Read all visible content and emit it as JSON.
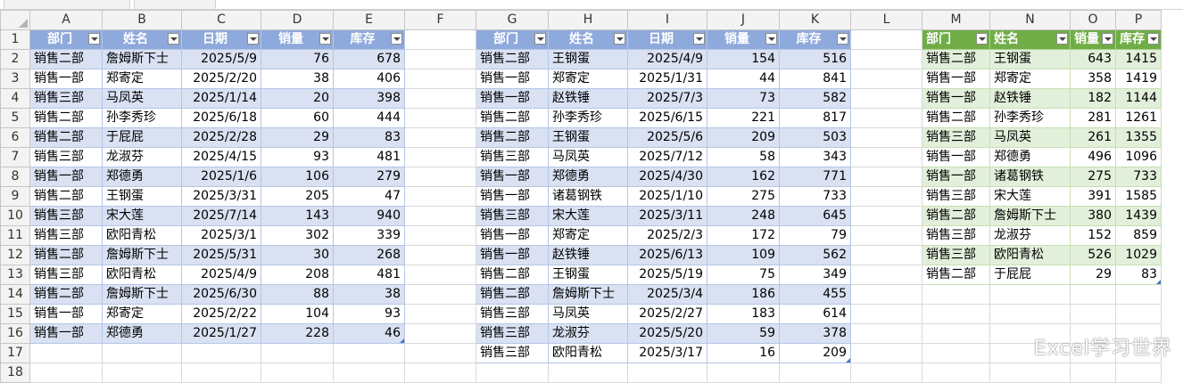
{
  "columns": [
    "A",
    "B",
    "C",
    "D",
    "E",
    "F",
    "G",
    "H",
    "I",
    "J",
    "K",
    "L",
    "M",
    "N",
    "O",
    "P"
  ],
  "row_numbers": [
    "1",
    "2",
    "3",
    "4",
    "5",
    "6",
    "7",
    "8",
    "9",
    "10",
    "11",
    "12",
    "13",
    "14",
    "15",
    "16",
    "17",
    "18"
  ],
  "table1": {
    "headers": [
      "部门",
      "姓名",
      "日期",
      "销量",
      "库存"
    ],
    "rows": [
      [
        "销售二部",
        "詹姆斯下士",
        "2025/5/9",
        "76",
        "678"
      ],
      [
        "销售一部",
        "郑寄定",
        "2025/2/20",
        "38",
        "406"
      ],
      [
        "销售三部",
        "马凤英",
        "2025/1/14",
        "20",
        "398"
      ],
      [
        "销售二部",
        "孙李秀珍",
        "2025/6/18",
        "60",
        "444"
      ],
      [
        "销售二部",
        "于屁屁",
        "2025/2/28",
        "29",
        "83"
      ],
      [
        "销售三部",
        "龙淑芬",
        "2025/4/15",
        "93",
        "481"
      ],
      [
        "销售一部",
        "郑德勇",
        "2025/1/6",
        "106",
        "279"
      ],
      [
        "销售二部",
        "王钢蛋",
        "2025/3/31",
        "205",
        "47"
      ],
      [
        "销售三部",
        "宋大莲",
        "2025/7/14",
        "143",
        "940"
      ],
      [
        "销售三部",
        "欧阳青松",
        "2025/3/1",
        "302",
        "339"
      ],
      [
        "销售二部",
        "詹姆斯下士",
        "2025/5/31",
        "30",
        "268"
      ],
      [
        "销售三部",
        "欧阳青松",
        "2025/4/9",
        "208",
        "481"
      ],
      [
        "销售二部",
        "詹姆斯下士",
        "2025/6/30",
        "88",
        "38"
      ],
      [
        "销售一部",
        "郑寄定",
        "2025/2/22",
        "104",
        "93"
      ],
      [
        "销售一部",
        "郑德勇",
        "2025/1/27",
        "228",
        "46"
      ]
    ]
  },
  "table2": {
    "headers": [
      "部门",
      "姓名",
      "日期",
      "销量",
      "库存"
    ],
    "rows": [
      [
        "销售二部",
        "王钢蛋",
        "2025/4/9",
        "154",
        "516"
      ],
      [
        "销售一部",
        "郑寄定",
        "2025/1/31",
        "44",
        "841"
      ],
      [
        "销售一部",
        "赵铁锤",
        "2025/7/3",
        "73",
        "582"
      ],
      [
        "销售二部",
        "孙李秀珍",
        "2025/6/15",
        "221",
        "817"
      ],
      [
        "销售二部",
        "王钢蛋",
        "2025/5/6",
        "209",
        "503"
      ],
      [
        "销售三部",
        "马凤英",
        "2025/7/12",
        "58",
        "343"
      ],
      [
        "销售一部",
        "郑德勇",
        "2025/4/30",
        "162",
        "771"
      ],
      [
        "销售一部",
        "诸葛钢铁",
        "2025/1/10",
        "275",
        "733"
      ],
      [
        "销售三部",
        "宋大莲",
        "2025/3/11",
        "248",
        "645"
      ],
      [
        "销售一部",
        "郑寄定",
        "2025/2/3",
        "172",
        "79"
      ],
      [
        "销售一部",
        "赵铁锤",
        "2025/6/13",
        "109",
        "562"
      ],
      [
        "销售二部",
        "王钢蛋",
        "2025/5/19",
        "75",
        "349"
      ],
      [
        "销售二部",
        "詹姆斯下士",
        "2025/3/4",
        "186",
        "455"
      ],
      [
        "销售三部",
        "马凤英",
        "2025/2/27",
        "183",
        "614"
      ],
      [
        "销售三部",
        "龙淑芬",
        "2025/5/20",
        "59",
        "378"
      ],
      [
        "销售三部",
        "欧阳青松",
        "2025/3/17",
        "16",
        "209"
      ]
    ]
  },
  "table3": {
    "headers": [
      "部门",
      "姓名",
      "销量",
      "库存"
    ],
    "rows": [
      [
        "销售二部",
        "王钢蛋",
        "643",
        "1415"
      ],
      [
        "销售一部",
        "郑寄定",
        "358",
        "1419"
      ],
      [
        "销售一部",
        "赵铁锤",
        "182",
        "1144"
      ],
      [
        "销售二部",
        "孙李秀珍",
        "281",
        "1261"
      ],
      [
        "销售三部",
        "马凤英",
        "261",
        "1355"
      ],
      [
        "销售一部",
        "郑德勇",
        "496",
        "1096"
      ],
      [
        "销售一部",
        "诸葛钢铁",
        "275",
        "733"
      ],
      [
        "销售三部",
        "宋大莲",
        "391",
        "1585"
      ],
      [
        "销售二部",
        "詹姆斯下士",
        "380",
        "1439"
      ],
      [
        "销售三部",
        "龙淑芬",
        "152",
        "859"
      ],
      [
        "销售三部",
        "欧阳青松",
        "526",
        "1029"
      ],
      [
        "销售二部",
        "于屁屁",
        "29",
        "83"
      ]
    ]
  },
  "watermark": "Excel学习世界",
  "colors": {
    "blue_header": "#8ea9db",
    "blue_band": "#d9e1f2",
    "green_header": "#70ad47",
    "green_band": "#e2efda"
  }
}
